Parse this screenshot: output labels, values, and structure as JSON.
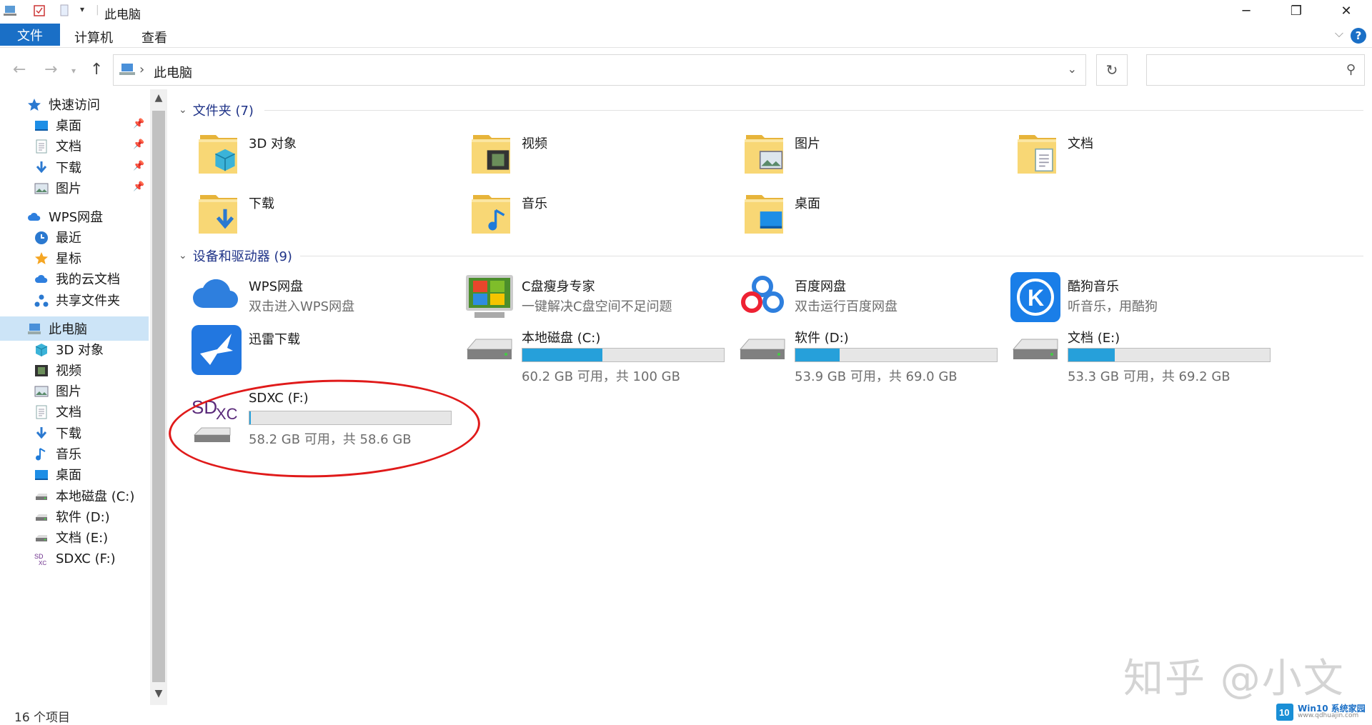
{
  "window": {
    "title": "此电脑",
    "controls": [
      "─",
      "❐",
      "✕"
    ]
  },
  "ribbon": {
    "tabs": [
      "文件",
      "计算机",
      "查看"
    ],
    "help_label": "?"
  },
  "address": {
    "crumb": "此电脑",
    "search_placeholder": ""
  },
  "sidebar": {
    "items": [
      {
        "label": "快速访问",
        "icon": "star-icon",
        "pinned": false,
        "level": 0
      },
      {
        "label": "桌面",
        "icon": "desktop-icon",
        "pinned": true,
        "level": 1
      },
      {
        "label": "文档",
        "icon": "document-icon",
        "pinned": true,
        "level": 1
      },
      {
        "label": "下载",
        "icon": "download-icon",
        "pinned": true,
        "level": 1
      },
      {
        "label": "图片",
        "icon": "picture-icon",
        "pinned": true,
        "level": 1
      },
      {
        "label": "WPS网盘",
        "icon": "cloud-icon",
        "pinned": false,
        "level": 0
      },
      {
        "label": "最近",
        "icon": "clock-icon",
        "pinned": false,
        "level": 1
      },
      {
        "label": "星标",
        "icon": "star-orange-icon",
        "pinned": false,
        "level": 1
      },
      {
        "label": "我的云文档",
        "icon": "cloud-icon",
        "pinned": false,
        "level": 1
      },
      {
        "label": "共享文件夹",
        "icon": "share-icon",
        "pinned": false,
        "level": 1
      },
      {
        "label": "此电脑",
        "icon": "computer-icon",
        "pinned": false,
        "level": 0,
        "selected": true
      },
      {
        "label": "3D 对象",
        "icon": "cube-icon",
        "pinned": false,
        "level": 1
      },
      {
        "label": "视频",
        "icon": "video-icon",
        "pinned": false,
        "level": 1
      },
      {
        "label": "图片",
        "icon": "picture-icon",
        "pinned": false,
        "level": 1
      },
      {
        "label": "文档",
        "icon": "document-icon",
        "pinned": false,
        "level": 1
      },
      {
        "label": "下载",
        "icon": "download-icon",
        "pinned": false,
        "level": 1
      },
      {
        "label": "音乐",
        "icon": "music-icon",
        "pinned": false,
        "level": 1
      },
      {
        "label": "桌面",
        "icon": "desktop-icon",
        "pinned": false,
        "level": 1
      },
      {
        "label": "本地磁盘 (C:)",
        "icon": "drive-icon",
        "pinned": false,
        "level": 1
      },
      {
        "label": "软件 (D:)",
        "icon": "drive-icon",
        "pinned": false,
        "level": 1
      },
      {
        "label": "文档 (E:)",
        "icon": "drive-icon",
        "pinned": false,
        "level": 1
      },
      {
        "label": "SDXC (F:)",
        "icon": "sd-card-icon",
        "pinned": false,
        "level": 1
      }
    ]
  },
  "folders": {
    "heading": "文件夹 (7)",
    "items": [
      {
        "label": "3D 对象",
        "icon": "cube-icon"
      },
      {
        "label": "视频",
        "icon": "video-icon"
      },
      {
        "label": "图片",
        "icon": "picture-icon"
      },
      {
        "label": "文档",
        "icon": "document-icon"
      },
      {
        "label": "下载",
        "icon": "download-icon"
      },
      {
        "label": "音乐",
        "icon": "music-icon"
      },
      {
        "label": "桌面",
        "icon": "desktop-icon"
      }
    ]
  },
  "devices": {
    "heading": "设备和驱动器 (9)",
    "apps": [
      {
        "label": "WPS网盘",
        "sub": "双击进入WPS网盘",
        "icon": "cloud-icon"
      },
      {
        "label": "C盘瘦身专家",
        "sub": "一键解决C盘空间不足问题",
        "icon": "windows-logo-icon"
      },
      {
        "label": "百度网盘",
        "sub": "双击运行百度网盘",
        "icon": "baidu-icon"
      },
      {
        "label": "酷狗音乐",
        "sub": "听音乐，用酷狗",
        "icon": "kugou-icon"
      },
      {
        "label": "迅雷下载",
        "sub": "",
        "icon": "thunder-icon"
      }
    ],
    "drives": [
      {
        "label": "本地磁盘 (C:)",
        "capacity": "60.2 GB 可用，共 100 GB",
        "used_fraction": 0.398,
        "icon": "drive-icon"
      },
      {
        "label": "软件 (D:)",
        "capacity": "53.9 GB 可用，共 69.0 GB",
        "used_fraction": 0.219,
        "icon": "drive-icon"
      },
      {
        "label": "文档 (E:)",
        "capacity": "53.3 GB 可用，共 69.2 GB",
        "used_fraction": 0.23,
        "icon": "drive-icon"
      },
      {
        "label": "SDXC (F:)",
        "capacity": "58.2 GB 可用，共 58.6 GB",
        "used_fraction": 0.007,
        "icon": "sd-card-icon",
        "annotated": true
      }
    ]
  },
  "status": {
    "count": "16 个项目"
  },
  "watermark": "知乎 @小文",
  "badge": {
    "text": "Win10 系统家园",
    "url_text": "www.qdhuajin.com"
  },
  "colors": {
    "accent": "#1a6fc6",
    "bar_fill": "#26a0da",
    "annotation": "#e01a1a",
    "selected": "#cce4f7"
  }
}
